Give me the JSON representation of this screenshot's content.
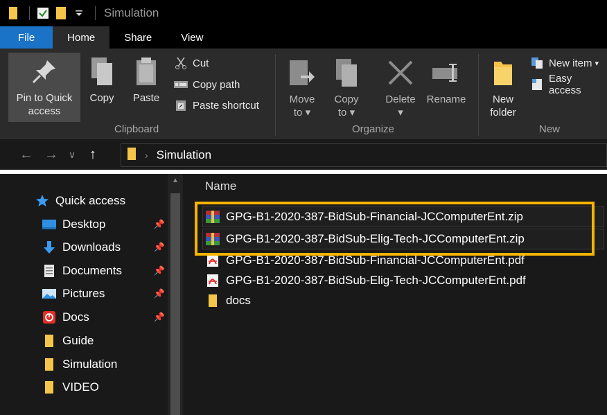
{
  "window": {
    "title": "Simulation"
  },
  "ribbon_tabs": [
    {
      "label": "File"
    },
    {
      "label": "Home"
    },
    {
      "label": "Share"
    },
    {
      "label": "View"
    }
  ],
  "clipboard": {
    "group_label": "Clipboard",
    "pin_label": "Pin to Quick access",
    "pin_line1": "Pin to Quick",
    "pin_line2": "access",
    "copy_label": "Copy",
    "paste_label": "Paste",
    "cut_label": "Cut",
    "copy_path_label": "Copy path",
    "paste_shortcut_label": "Paste shortcut"
  },
  "organize": {
    "group_label": "Organize",
    "move_to_line1": "Move",
    "move_to_line2": "to",
    "copy_to_line1": "Copy",
    "copy_to_line2": "to",
    "delete_label": "Delete",
    "rename_label": "Rename"
  },
  "new_group": {
    "group_label": "New",
    "new_folder_line1": "New",
    "new_folder_line2": "folder",
    "new_item_label": "New item",
    "easy_access_label": "Easy access"
  },
  "address": {
    "path": [
      "Simulation"
    ]
  },
  "navigation": {
    "items": [
      {
        "label": "Quick access",
        "icon": "star-icon",
        "pinned": false
      },
      {
        "label": "Desktop",
        "icon": "desktop-icon",
        "pinned": true
      },
      {
        "label": "Downloads",
        "icon": "download-icon",
        "pinned": true
      },
      {
        "label": "Documents",
        "icon": "documents-icon",
        "pinned": true
      },
      {
        "label": "Pictures",
        "icon": "pictures-icon",
        "pinned": true
      },
      {
        "label": "Docs",
        "icon": "docs-red-icon",
        "pinned": true
      },
      {
        "label": "Guide",
        "icon": "folder-icon",
        "pinned": false
      },
      {
        "label": "Simulation",
        "icon": "folder-icon",
        "pinned": false
      },
      {
        "label": "VIDEO",
        "icon": "folder-icon",
        "pinned": false
      }
    ]
  },
  "file_list": {
    "column_header": "Name",
    "files": [
      {
        "name": "GPG-B1-2020-387-BidSub-Financial-JCComputerEnt.zip",
        "icon": "winrar-archive-icon"
      },
      {
        "name": "GPG-B1-2020-387-BidSub-Elig-Tech-JCComputerEnt.zip",
        "icon": "winrar-archive-icon"
      },
      {
        "name": "GPG-B1-2020-387-BidSub-Financial-JCComputerEnt.pdf",
        "icon": "pdf-icon"
      },
      {
        "name": "GPG-B1-2020-387-BidSub-Elig-Tech-JCComputerEnt.pdf",
        "icon": "pdf-icon"
      },
      {
        "name": "docs",
        "icon": "folder-icon"
      }
    ]
  },
  "colors": {
    "file_tab": "#1a73c6",
    "highlight_box": "#f6b400",
    "folder_yellow": "#f5c54a",
    "quick_access_star": "#3b9bf2",
    "pdf_red": "#e0302a"
  }
}
